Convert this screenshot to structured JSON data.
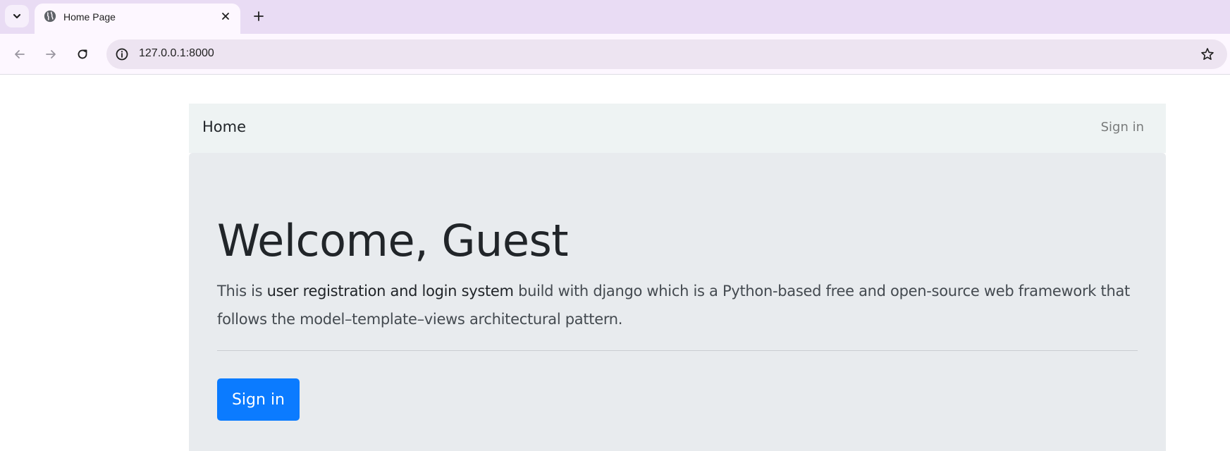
{
  "browser": {
    "tab": {
      "title": "Home Page",
      "favicon": "globe-icon"
    },
    "address_bar": {
      "url": "127.0.0.1:8000"
    }
  },
  "page": {
    "navbar": {
      "brand": "Home",
      "signin_link": "Sign in"
    },
    "jumbotron": {
      "heading": "Welcome, Guest",
      "lead_prefix": "This is ",
      "lead_bold": "user registration and login system",
      "lead_suffix": " build with django which is a Python-based free and open-source web framework that follows the model–template–views architectural pattern.",
      "button_label": "Sign in"
    }
  },
  "colors": {
    "tabstrip_bg": "#e9dcf4",
    "toolbar_bg": "#fdf7ff",
    "omnibox_bg": "#ede4f1",
    "navbar_bg": "#eef3f3",
    "jumbotron_bg": "#e8ebee",
    "primary_button": "#0b7bff"
  }
}
